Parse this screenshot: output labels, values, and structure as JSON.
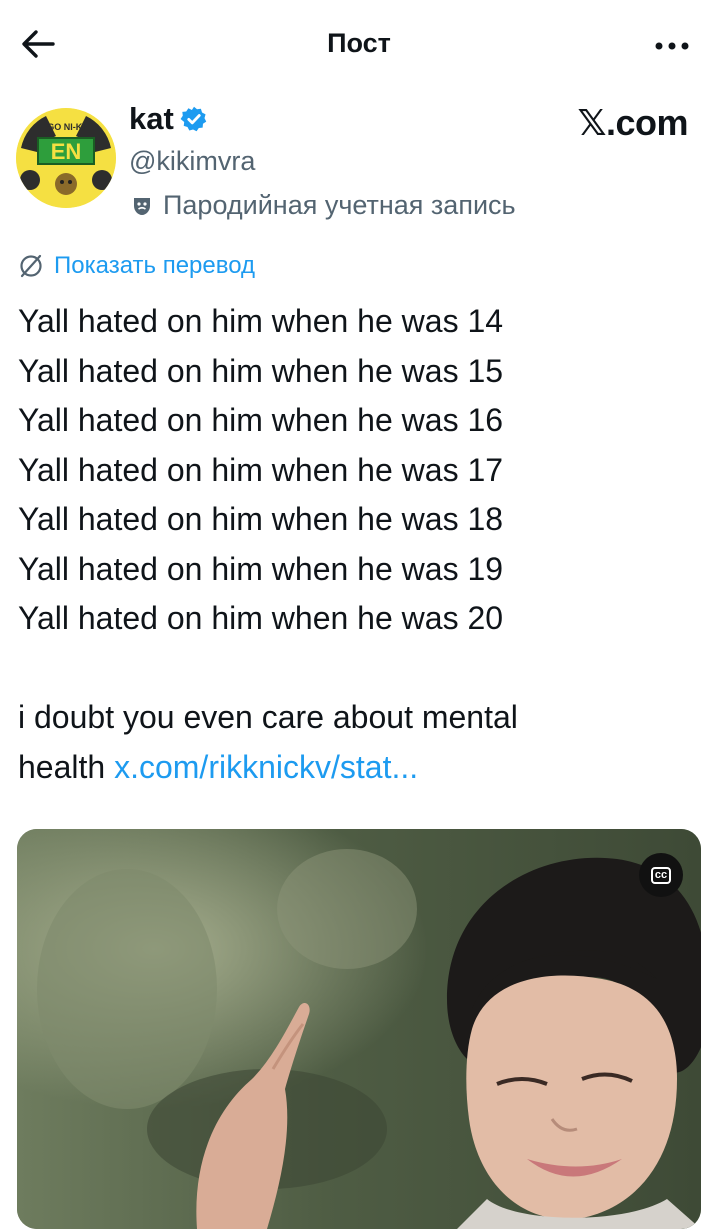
{
  "header": {
    "title": "Пост",
    "back_icon": "arrow-left-icon",
    "more_icon": "more-horizontal-icon"
  },
  "author": {
    "display_name": "kat",
    "handle": "@kikimvra",
    "parody_label": "Пародийная учетная запись",
    "verified_icon": "verified-badge-icon",
    "avatar_text": "EN",
    "avatar_top_text": "GO NI-KI"
  },
  "watermark": "𝕏.com",
  "translate": {
    "label": "Показать перевод",
    "icon": "translate-icon"
  },
  "tweet": {
    "lines": [
      "Yall hated on him when he was 14",
      "Yall hated on him when he was 15",
      "Yall hated on him when he was 16",
      "Yall hated on him when he was 17",
      "Yall hated on him when he was 18",
      "Yall hated on him when he was 19",
      "Yall hated on him when he was 20"
    ],
    "closing_line": "i doubt you even care about mental",
    "closing_prefix": "health ",
    "link_text": "x.com/rikknickv/stat..."
  },
  "media": {
    "cc_label": "cc"
  },
  "colors": {
    "accent": "#1d9bf0",
    "text": "#0f1419",
    "secondary": "#536471"
  }
}
